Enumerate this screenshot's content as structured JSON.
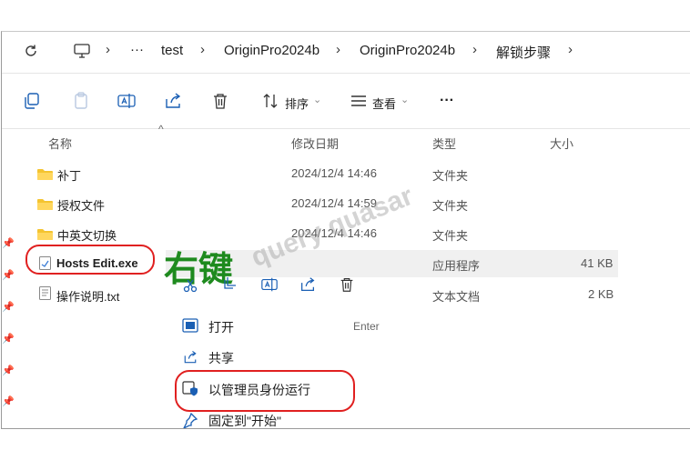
{
  "breadcrumb": {
    "more": "···",
    "items": [
      "test",
      "OriginPro2024b",
      "OriginPro2024b",
      "解锁步骤"
    ]
  },
  "toolbar": {
    "sort_label": "排序",
    "view_label": "查看",
    "more": "···"
  },
  "columns": {
    "name": "名称",
    "modified": "修改日期",
    "type": "类型",
    "size": "大小"
  },
  "files": [
    {
      "name": "补丁",
      "modified": "2024/12/4 14:46",
      "type": "文件夹",
      "size": "",
      "icon": "folder-icon"
    },
    {
      "name": "授权文件",
      "modified": "2024/12/4 14:59",
      "type": "文件夹",
      "size": "",
      "icon": "folder-icon"
    },
    {
      "name": "中英文切换",
      "modified": "2024/12/4 14:46",
      "type": "文件夹",
      "size": "",
      "icon": "folder-icon"
    },
    {
      "name": "Hosts Edit.exe",
      "modified": "",
      "type": "应用程序",
      "size": "41 KB",
      "icon": "exe-icon"
    },
    {
      "name": "操作说明.txt",
      "modified": "",
      "type": "文本文档",
      "size": "2 KB",
      "icon": "txt-icon"
    }
  ],
  "annotation": {
    "right_click": "右键",
    "watermark": "query quasar"
  },
  "context_menu": {
    "items": [
      {
        "label": "打开",
        "shortcut": "Enter",
        "icon": "open-icon"
      },
      {
        "label": "共享",
        "shortcut": "",
        "icon": "share-icon"
      },
      {
        "label": "以管理员身份运行",
        "shortcut": "",
        "icon": "admin-shield-icon"
      },
      {
        "label": "固定到\"开始\"",
        "shortcut": "",
        "icon": "pin-icon"
      }
    ]
  },
  "colors": {
    "accent": "#1a5fb4",
    "annotation_green": "#1e8a1e",
    "highlight_red": "#e02020",
    "folder_yellow": "#f4c430"
  }
}
